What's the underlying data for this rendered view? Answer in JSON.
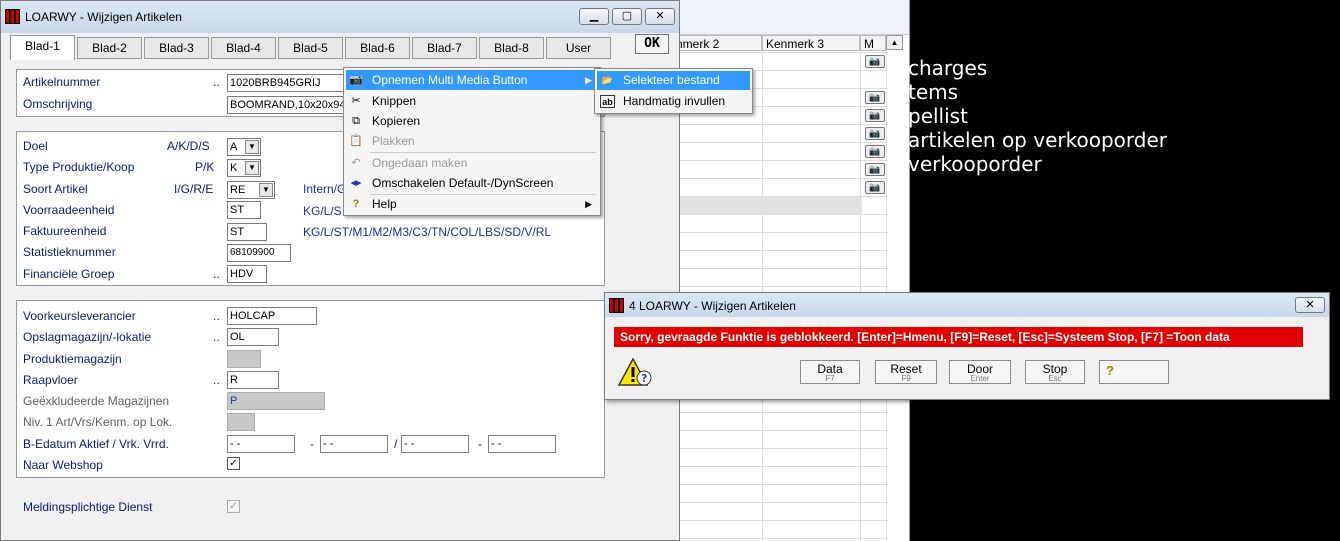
{
  "background_grid": {
    "columns": [
      "nmerk 2",
      "Kenmerk 3",
      "M"
    ],
    "camera_rows": 7
  },
  "console_lines": [
    "charges",
    "tems",
    "pellist",
    "artikelen op verkooporder",
    "verkooporder"
  ],
  "main_window": {
    "title": "LOARWY - Wijzigen Artikelen",
    "tabs": [
      "Blad-1",
      "Blad-2",
      "Blad-3",
      "Blad-4",
      "Blad-5",
      "Blad-6",
      "Blad-7",
      "Blad-8",
      "User"
    ],
    "active_tab": "Blad-1",
    "ok_label": "OK",
    "panel1": {
      "artikelnummer_label": "Artikelnummer",
      "artikelnummer_value": "1020BRB945GRIJ",
      "omschrijving_label": "Omschrijving",
      "omschrijving_value": "BOOMRAND,10x20x94",
      "dots": ".."
    },
    "panel2": {
      "doel_label": "Doel",
      "doel_code": "A/K/D/S",
      "doel_value": "A",
      "type_label": "Type Produktie/Koop",
      "type_code": "P/K",
      "type_value": "K",
      "soort_label": "Soort Artikel",
      "soort_code": "I/G/R/E",
      "soort_value": "RE",
      "soort_hint": "Intern/G",
      "voorraad_label": "Voorraadeenheid",
      "voorraad_value": "ST",
      "voorraad_hint": "KG/L/S",
      "faktuur_label": "Faktuureenheid",
      "faktuur_value": "ST",
      "faktuur_hint": "KG/L/ST/M1/M2/M3/C3/TN/COL/LBS/SD/V/RL",
      "stat_label": "Statistieknummer",
      "stat_value": "68109900",
      "fin_label": "Financiële Groep",
      "fin_value": "HDV"
    },
    "panel3": {
      "voorkeur_label": "Voorkeursleverancier",
      "voorkeur_value": "HOLCAP",
      "opslag_label": "Opslagmagazijn/-lokatie",
      "opslag_value": "OL",
      "produktie_label": "Produktiemagazijn",
      "raapvloer_label": "Raapvloer",
      "raapvloer_value": "R",
      "geexcl_label": "Geëxkludeerde Magazijnen",
      "geexcl_value": "P",
      "niv_label": "Niv. 1 Art/Vrs/Kenm. op Lok.",
      "bedatum_label": "B-Edatum Aktief / Vrk. Vrrd.",
      "date_placeholder": "- -",
      "sep1": "-",
      "sep2": "/",
      "sep3": "-",
      "webshop_label": "Naar Webshop"
    },
    "meldings_label": "Meldingsplichtige Dienst"
  },
  "context_menu": {
    "items": [
      {
        "label": "Opnemen Multi Media Button",
        "icon": "camera-icon",
        "selected": true,
        "submenu": true
      },
      {
        "label": "Knippen",
        "icon": "scissors-icon"
      },
      {
        "label": "Kopieren",
        "icon": "copy-icon"
      },
      {
        "label": "Plakken",
        "icon": "paste-icon",
        "disabled": true
      },
      {
        "label": "Ongedaan maken",
        "icon": "undo-icon",
        "disabled": true
      },
      {
        "label": "Omschakelen Default-/DynScreen",
        "icon": "switch-icon"
      },
      {
        "label": "Help",
        "icon": "help-icon",
        "submenu": true
      }
    ],
    "submenu": [
      {
        "label": "Selekteer bestand",
        "icon": "folder-icon",
        "selected": true
      },
      {
        "label": "Handmatig invullen",
        "icon": "text-field-icon"
      }
    ]
  },
  "dialog": {
    "title": "4 LOARWY - Wijzigen Artikelen",
    "message": "Sorry, gevraagde Funktie is geblokkeerd.  [Enter]=Hmenu, [F9]=Reset, [Esc]=Systeem Stop, [F7] =Toon data",
    "buttons": [
      {
        "label": "Data",
        "key": "F7"
      },
      {
        "label": "Reset",
        "key": "F9"
      },
      {
        "label": "Door",
        "key": "Enter"
      },
      {
        "label": "Stop",
        "key": "Esc"
      }
    ]
  }
}
